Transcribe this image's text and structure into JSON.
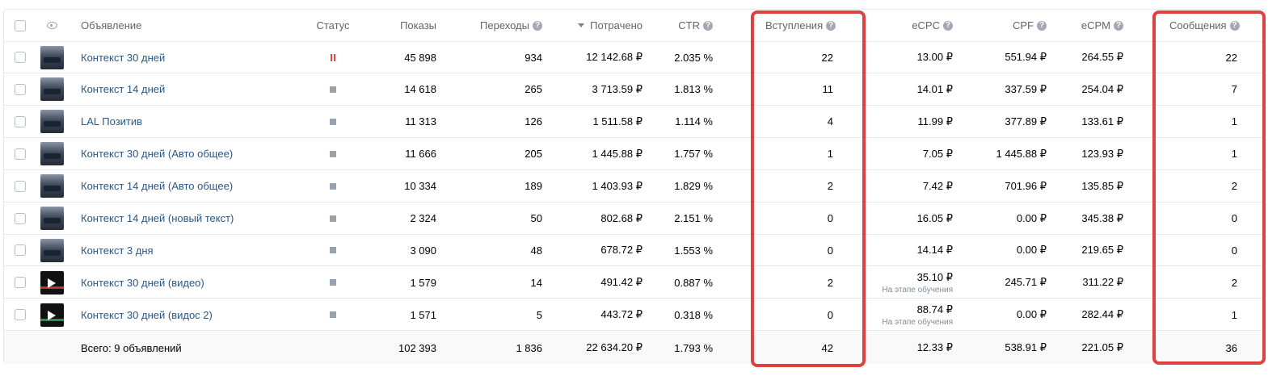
{
  "header": {
    "ad": "Объявление",
    "status": "Статус",
    "impressions": "Показы",
    "clicks": "Переходы",
    "spent": "Потрачено",
    "ctr": "CTR",
    "joins": "Вступления",
    "ecpc": "eCPC",
    "cpf": "CPF",
    "ecpm": "eCPM",
    "messages": "Сообщения"
  },
  "help_glyph": "?",
  "sort": {
    "column": "spent",
    "direction": "desc"
  },
  "rows": [
    {
      "name": "Контекст 30 дней",
      "status": "paused",
      "impressions": "45 898",
      "clicks": "934",
      "spent": "12 142.68 ₽",
      "ctr": "2.035 %",
      "joins": "22",
      "ecpc": "13.00 ₽",
      "ecpc_note": "",
      "cpf": "551.94 ₽",
      "ecpm": "264.55 ₽",
      "messages": "22",
      "thumb": "car-photo"
    },
    {
      "name": "Контекст 14 дней",
      "status": "stopped",
      "impressions": "14 618",
      "clicks": "265",
      "spent": "3 713.59 ₽",
      "ctr": "1.813 %",
      "joins": "11",
      "ecpc": "14.01 ₽",
      "ecpc_note": "",
      "cpf": "337.59 ₽",
      "ecpm": "254.04 ₽",
      "messages": "7",
      "thumb": "car-photo"
    },
    {
      "name": "LAL Позитив",
      "status": "stopped",
      "impressions": "11 313",
      "clicks": "126",
      "spent": "1 511.58 ₽",
      "ctr": "1.114 %",
      "joins": "4",
      "ecpc": "11.99 ₽",
      "ecpc_note": "",
      "cpf": "377.89 ₽",
      "ecpm": "133.61 ₽",
      "messages": "1",
      "thumb": "car-photo"
    },
    {
      "name": "Контекст 30 дней (Авто общее)",
      "status": "stopped",
      "impressions": "11 666",
      "clicks": "205",
      "spent": "1 445.88 ₽",
      "ctr": "1.757 %",
      "joins": "1",
      "ecpc": "7.05 ₽",
      "ecpc_note": "",
      "cpf": "1 445.88 ₽",
      "ecpm": "123.93 ₽",
      "messages": "1",
      "thumb": "car-photo"
    },
    {
      "name": "Контекст 14 дней (Авто общее)",
      "status": "stopped",
      "impressions": "10 334",
      "clicks": "189",
      "spent": "1 403.93 ₽",
      "ctr": "1.829 %",
      "joins": "2",
      "ecpc": "7.42 ₽",
      "ecpc_note": "",
      "cpf": "701.96 ₽",
      "ecpm": "135.85 ₽",
      "messages": "2",
      "thumb": "car-photo"
    },
    {
      "name": "Контекст 14 дней (новый текст)",
      "status": "stopped",
      "impressions": "2 324",
      "clicks": "50",
      "spent": "802.68 ₽",
      "ctr": "2.151 %",
      "joins": "0",
      "ecpc": "16.05 ₽",
      "ecpc_note": "",
      "cpf": "0.00 ₽",
      "ecpm": "345.38 ₽",
      "messages": "0",
      "thumb": "car-photo"
    },
    {
      "name": "Контекст 3 дня",
      "status": "stopped",
      "impressions": "3 090",
      "clicks": "48",
      "spent": "678.72 ₽",
      "ctr": "1.553 %",
      "joins": "0",
      "ecpc": "14.14 ₽",
      "ecpc_note": "",
      "cpf": "0.00 ₽",
      "ecpm": "219.65 ₽",
      "messages": "0",
      "thumb": "car-photo"
    },
    {
      "name": "Контекст 30 дней (видео)",
      "status": "stopped",
      "impressions": "1 579",
      "clicks": "14",
      "spent": "491.42 ₽",
      "ctr": "0.887 %",
      "joins": "2",
      "ecpc": "35.10 ₽",
      "ecpc_note": "На этапе обучения",
      "cpf": "245.71 ₽",
      "ecpm": "311.22 ₽",
      "messages": "2",
      "thumb": "video-red"
    },
    {
      "name": "Контекст 30 дней (видос 2)",
      "status": "stopped",
      "impressions": "1 571",
      "clicks": "5",
      "spent": "443.72 ₽",
      "ctr": "0.318 %",
      "joins": "0",
      "ecpc": "88.74 ₽",
      "ecpc_note": "На этапе обучения",
      "cpf": "0.00 ₽",
      "ecpm": "282.44 ₽",
      "messages": "1",
      "thumb": "video-green"
    }
  ],
  "total": {
    "label": "Всего: 9 объявлений",
    "impressions": "102 393",
    "clicks": "1 836",
    "spent": "22 634.20 ₽",
    "ctr": "1.793 %",
    "joins": "42",
    "ecpc": "12.33 ₽",
    "cpf": "538.91 ₽",
    "ecpm": "221.05 ₽",
    "messages": "36"
  },
  "highlight_color": "#e0413f",
  "highlighted_columns": [
    "joins",
    "messages"
  ]
}
